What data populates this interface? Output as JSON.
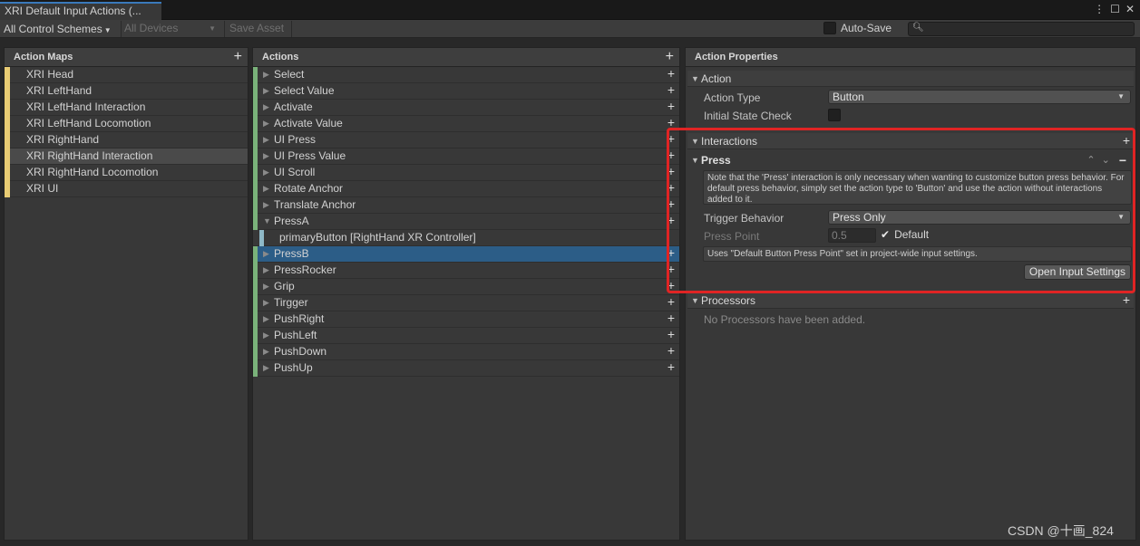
{
  "window": {
    "tab_title": "XRI Default Input Actions (...",
    "tab_actions": [
      "⋮",
      "☐",
      "✕"
    ]
  },
  "toolbar": {
    "control_schemes": "All Control Schemes",
    "devices": "All Devices",
    "save_asset": "Save Asset",
    "auto_save": "Auto-Save",
    "search_placeholder": ""
  },
  "action_maps": {
    "header": "Action Maps",
    "add": "+",
    "items": [
      {
        "label": "XRI Head"
      },
      {
        "label": "XRI LeftHand"
      },
      {
        "label": "XRI LeftHand Interaction"
      },
      {
        "label": "XRI LeftHand Locomotion"
      },
      {
        "label": "XRI RightHand"
      },
      {
        "label": "XRI RightHand Interaction"
      },
      {
        "label": "XRI RightHand Locomotion"
      },
      {
        "label": "XRI UI"
      }
    ],
    "selected": "XRI RightHand Interaction"
  },
  "actions": {
    "header": "Actions",
    "add": "+",
    "items": [
      {
        "label": "Select",
        "arrow": "▶"
      },
      {
        "label": "Select Value",
        "arrow": "▶"
      },
      {
        "label": "Activate",
        "arrow": "▶"
      },
      {
        "label": "Activate Value",
        "arrow": "▶"
      },
      {
        "label": "UI Press",
        "arrow": "▶"
      },
      {
        "label": "UI Press Value",
        "arrow": "▶"
      },
      {
        "label": "UI Scroll",
        "arrow": "▶"
      },
      {
        "label": "Rotate Anchor",
        "arrow": "▶"
      },
      {
        "label": "Translate Anchor",
        "arrow": "▶"
      },
      {
        "label": "PressA",
        "arrow": "▼"
      },
      {
        "label": "PressB",
        "arrow": "▶"
      },
      {
        "label": "PressRocker",
        "arrow": "▶"
      },
      {
        "label": "Grip",
        "arrow": "▶"
      },
      {
        "label": "Tirgger",
        "arrow": "▶"
      },
      {
        "label": "PushRight",
        "arrow": "▶"
      },
      {
        "label": "PushLeft",
        "arrow": "▶"
      },
      {
        "label": "PushDown",
        "arrow": "▶"
      },
      {
        "label": "PushUp",
        "arrow": "▶"
      }
    ],
    "binding": "primaryButton [RightHand XR Controller]",
    "selected": "PressB"
  },
  "properties": {
    "header": "Action Properties",
    "action_section": "Action",
    "action_type_label": "Action Type",
    "action_type_value": "Button",
    "initial_state_label": "Initial State Check",
    "interactions_section": "Interactions",
    "press_header": "Press",
    "press_help": "Note that the 'Press' interaction is only necessary when wanting to customize button press behavior. For default press behavior, simply set the action type to 'Button' and use the action without interactions added to it.",
    "trigger_behavior_label": "Trigger Behavior",
    "trigger_behavior_value": "Press Only",
    "press_point_label": "Press Point",
    "press_point_value": "0.5",
    "default_label": "Default",
    "default_note": "Uses \"Default Button Press Point\" set in project-wide input settings.",
    "open_settings": "Open Input Settings",
    "processors_section": "Processors",
    "processors_empty": "No Processors have been added."
  },
  "watermark": "CSDN @十画_824",
  "colors": {
    "map_stripe": "#e9cc74",
    "action_stripe": "#7ab27a",
    "binding_stripe": "#8fb9c7",
    "selection": "#2c5d87",
    "annotation": "#e02424"
  }
}
